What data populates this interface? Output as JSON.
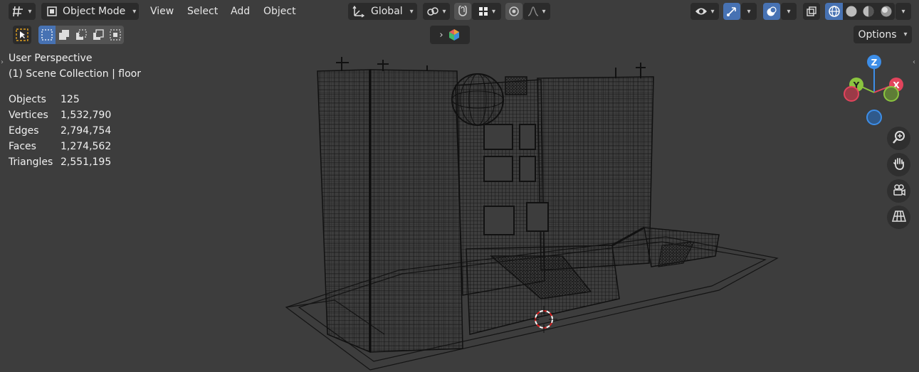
{
  "header": {
    "mode_label": "Object Mode",
    "menus": [
      "View",
      "Select",
      "Add",
      "Object"
    ],
    "transform_orientation": "Global",
    "options_label": "Options"
  },
  "overlay": {
    "view_name": "User Perspective",
    "collection": "(1) Scene Collection | floor"
  },
  "stats": [
    {
      "key": "Objects",
      "value": "125"
    },
    {
      "key": "Vertices",
      "value": "1,532,790"
    },
    {
      "key": "Edges",
      "value": "2,794,754"
    },
    {
      "key": "Faces",
      "value": "1,274,562"
    },
    {
      "key": "Triangles",
      "value": "2,551,195"
    }
  ],
  "gizmo": {
    "z_label": "Z",
    "y_label": "Y",
    "x_label": "X",
    "colors": {
      "x": "#e2445c",
      "y": "#8bc53f",
      "z": "#3d8ee8"
    }
  },
  "icons": {
    "editor_type": "grid-icon",
    "mode": "object-mode-icon",
    "orientation": "axes-icon",
    "pivot": "link-icon",
    "snap": "magnet-icon",
    "snap_target": "grid-snap-icon",
    "proportional": "circle-dot-icon",
    "falloff": "curve-icon",
    "visibility": "eye-icon",
    "gizmo_toggle": "gizmo-icon",
    "overlay_toggle": "overlay-icon",
    "xray": "xray-icon",
    "wireframe": "wireframe-shading-icon",
    "solid": "solid-shading-icon",
    "material": "material-shading-icon",
    "rendered": "rendered-shading-icon",
    "zoom": "zoom-icon",
    "pan": "hand-icon",
    "camera": "camera-icon",
    "grid_view": "grid-view-icon"
  },
  "colors": {
    "accent": "#4772b3",
    "background": "#3d3d3d",
    "button": "#2b2b2b",
    "origin_marker": "#ffffff"
  }
}
